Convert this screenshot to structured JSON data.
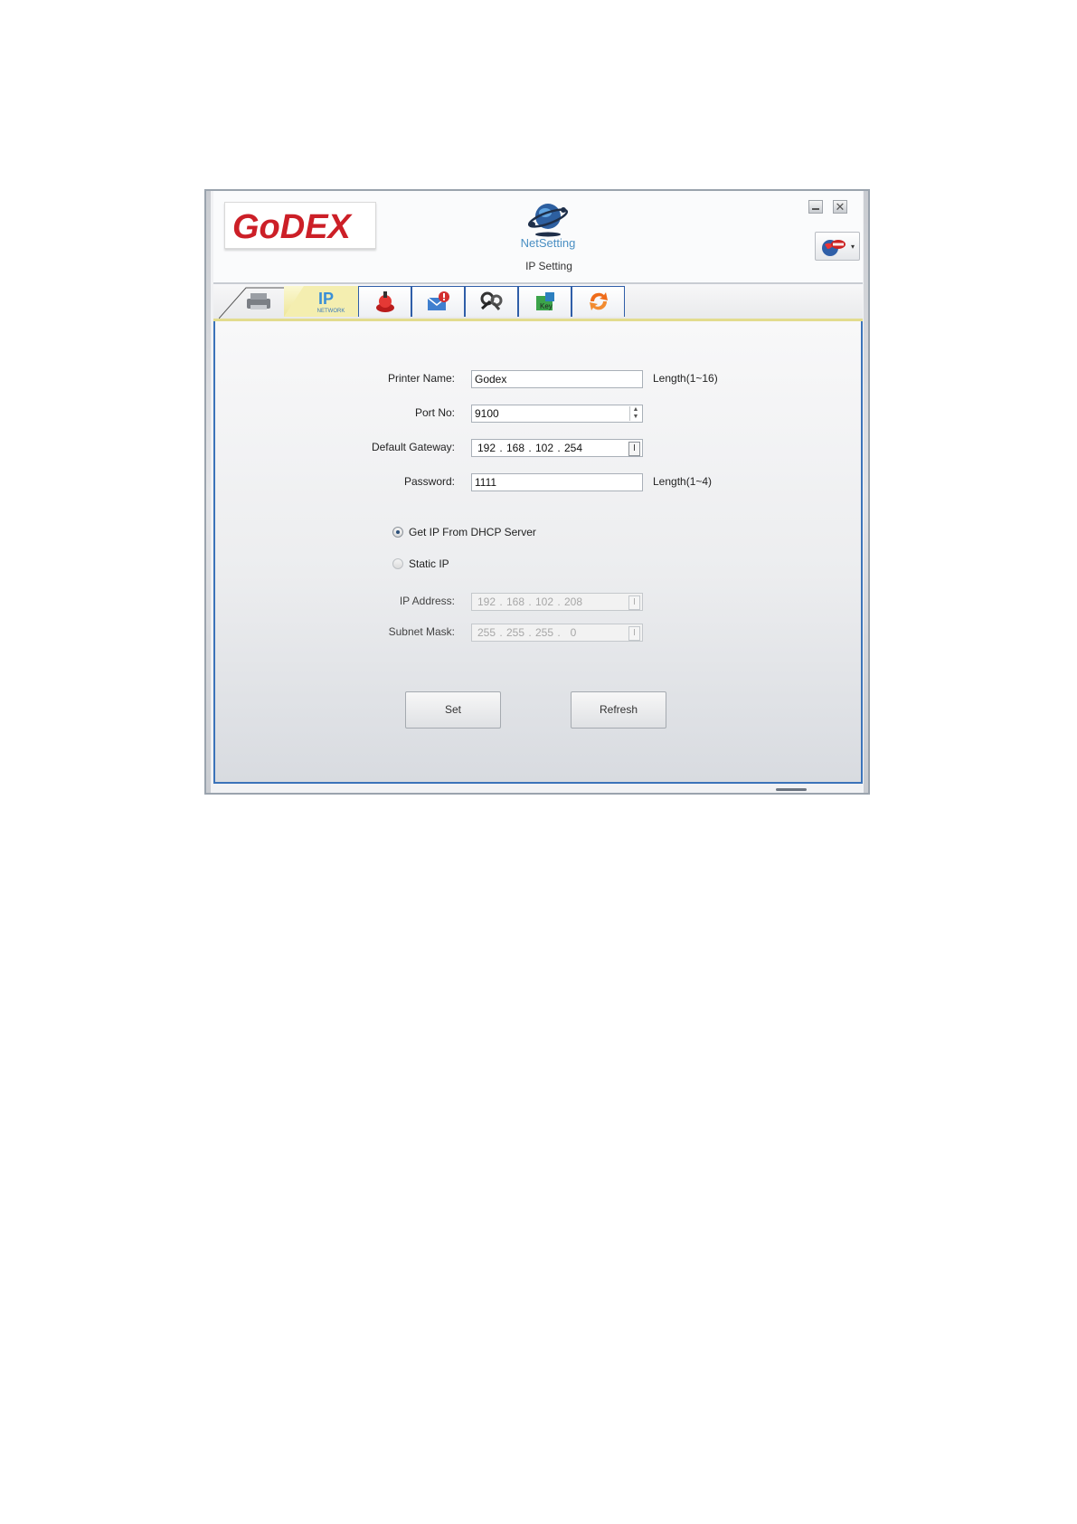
{
  "app": {
    "logo_text": "GoDEX",
    "product_name": "NetSetting",
    "page_title": "IP Setting",
    "window_controls": {
      "minimize_icon": "minimize-icon",
      "close_label": "✕"
    },
    "language_button": {
      "icon": "language-globe-icon",
      "arrow": "▾"
    }
  },
  "tabs": [
    {
      "name": "printer",
      "icon": "printer-icon",
      "active": false
    },
    {
      "name": "ip-network",
      "icon": "ip-network-icon",
      "label": "NETWORK",
      "active": true
    },
    {
      "name": "alert",
      "icon": "alert-bell-icon",
      "active": false
    },
    {
      "name": "mail-alert",
      "icon": "mail-alert-icon",
      "active": false
    },
    {
      "name": "tools",
      "icon": "tools-icon",
      "active": false
    },
    {
      "name": "key",
      "icon": "key-icon",
      "active": false
    },
    {
      "name": "refresh",
      "icon": "refresh-arrows-icon",
      "active": false
    }
  ],
  "form": {
    "printer_name": {
      "label": "Printer Name:",
      "value": "Godex",
      "hint": "Length(1~16)"
    },
    "port_no": {
      "label": "Port No:",
      "value": "9100",
      "spin_up": "▲",
      "spin_down": "▼"
    },
    "default_gateway": {
      "label": "Default Gateway:",
      "octets": [
        "192",
        "168",
        "102",
        "254"
      ],
      "dot": ".",
      "ibeam": "I"
    },
    "password": {
      "label": "Password:",
      "value": "1111",
      "hint": "Length(1~4)"
    },
    "dhcp_option": {
      "label": "Get IP From DHCP Server",
      "selected": true
    },
    "static_option": {
      "label": "Static IP",
      "selected": false
    },
    "ip_address": {
      "label": "IP Address:",
      "octets": [
        "192",
        "168",
        "102",
        "208"
      ],
      "dot": ".",
      "ibeam": "I",
      "enabled": false
    },
    "subnet_mask": {
      "label": "Subnet Mask:",
      "octets": [
        "255",
        "255",
        "255",
        "0"
      ],
      "dot": ".",
      "ibeam": "I",
      "enabled": false
    }
  },
  "buttons": {
    "set": "Set",
    "refresh": "Refresh"
  },
  "colors": {
    "logo_red": "#cc1f27",
    "active_tab": "#eee69a",
    "frame_blue": "#3b73b9"
  }
}
